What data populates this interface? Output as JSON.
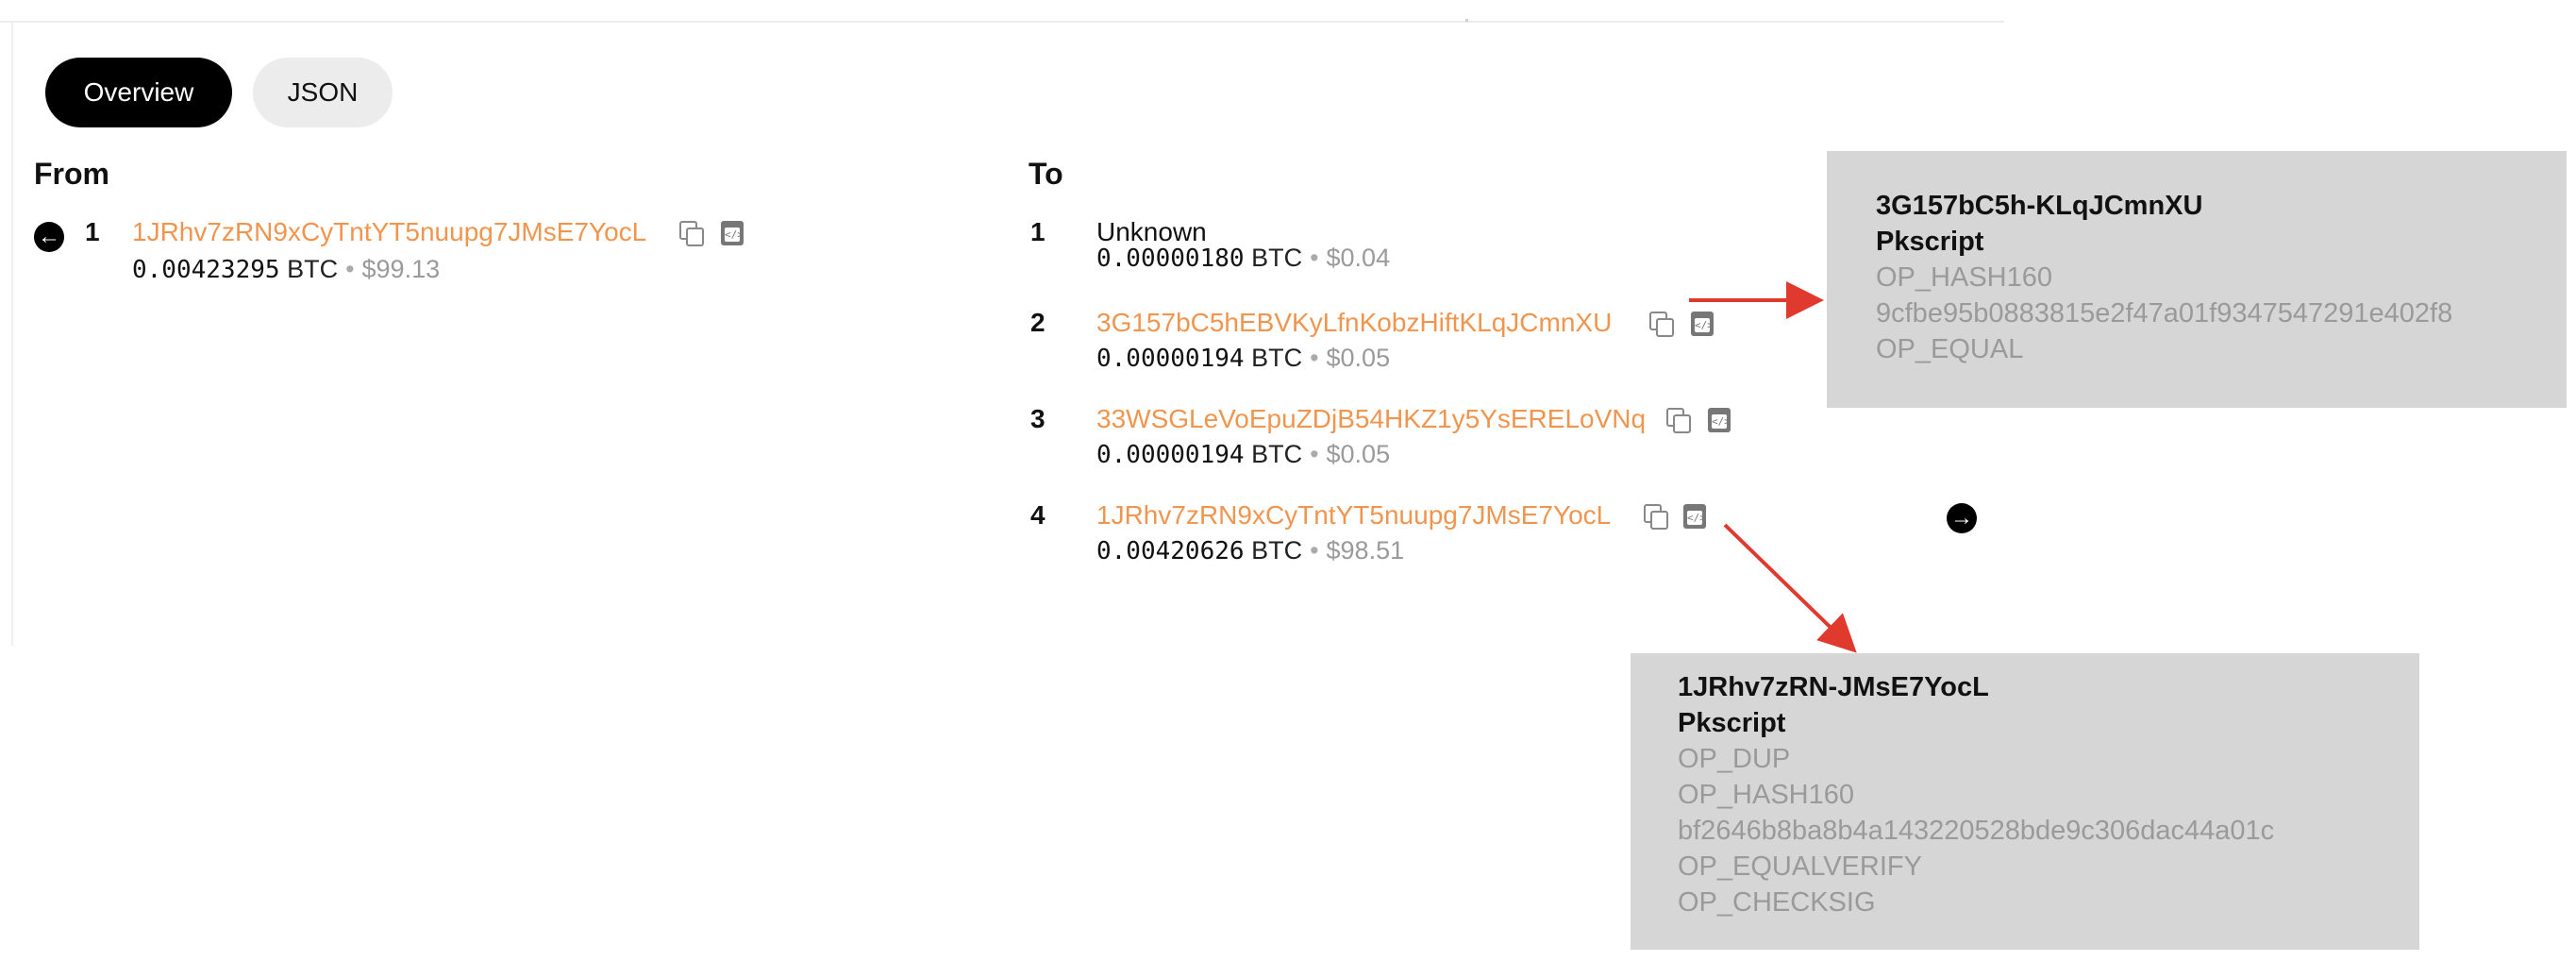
{
  "tabs": {
    "overview": "Overview",
    "json": "JSON"
  },
  "from": {
    "heading": "From",
    "inputs": [
      {
        "index": "1",
        "address": "1JRhv7zRN9xCyTntYT5nuupg7JMsE7YocL",
        "btc": "0.00423295",
        "unit": "BTC",
        "usd": "$99.13"
      }
    ]
  },
  "to": {
    "heading": "To",
    "outputs": [
      {
        "index": "1",
        "address": "Unknown",
        "btc": "0.00000180",
        "unit": "BTC",
        "usd": "$0.04"
      },
      {
        "index": "2",
        "address": "3G157bC5hEBVKyLfnKobzHiftKLqJCmnXU",
        "btc": "0.00000194",
        "unit": "BTC",
        "usd": "$0.05"
      },
      {
        "index": "3",
        "address": "33WSGLeVoEpuZDjB54HKZ1y5YsERELoVNq",
        "btc": "0.00000194",
        "unit": "BTC",
        "usd": "$0.05"
      },
      {
        "index": "4",
        "address": "1JRhv7zRN9xCyTntYT5nuupg7JMsE7YocL",
        "btc": "0.00420626",
        "unit": "BTC",
        "usd": "$98.51"
      }
    ]
  },
  "callouts": [
    {
      "address": "3G157bC5h-KLqJCmnXU",
      "label": "Pkscript",
      "lines": [
        "OP_HASH160",
        "9cfbe95b0883815e2f47a01f9347547291e402f8",
        "OP_EQUAL"
      ]
    },
    {
      "address": "1JRhv7zRN-JMsE7YocL",
      "label": "Pkscript",
      "lines": [
        "OP_DUP",
        "OP_HASH160",
        "bf2646b8ba8b4a143220528bde9c306dac44a01c",
        "OP_EQUALVERIFY",
        "OP_CHECKSIG"
      ]
    }
  ],
  "icons": {
    "input_nav": "arrow-left-circle-icon",
    "output_nav": "arrow-right-circle-icon",
    "copy": "copy-icon",
    "script": "script-icon"
  },
  "colors": {
    "address": "#f0954e",
    "callout_bg": "#d6d6d6",
    "annotation_arrow": "#e03a2f"
  }
}
